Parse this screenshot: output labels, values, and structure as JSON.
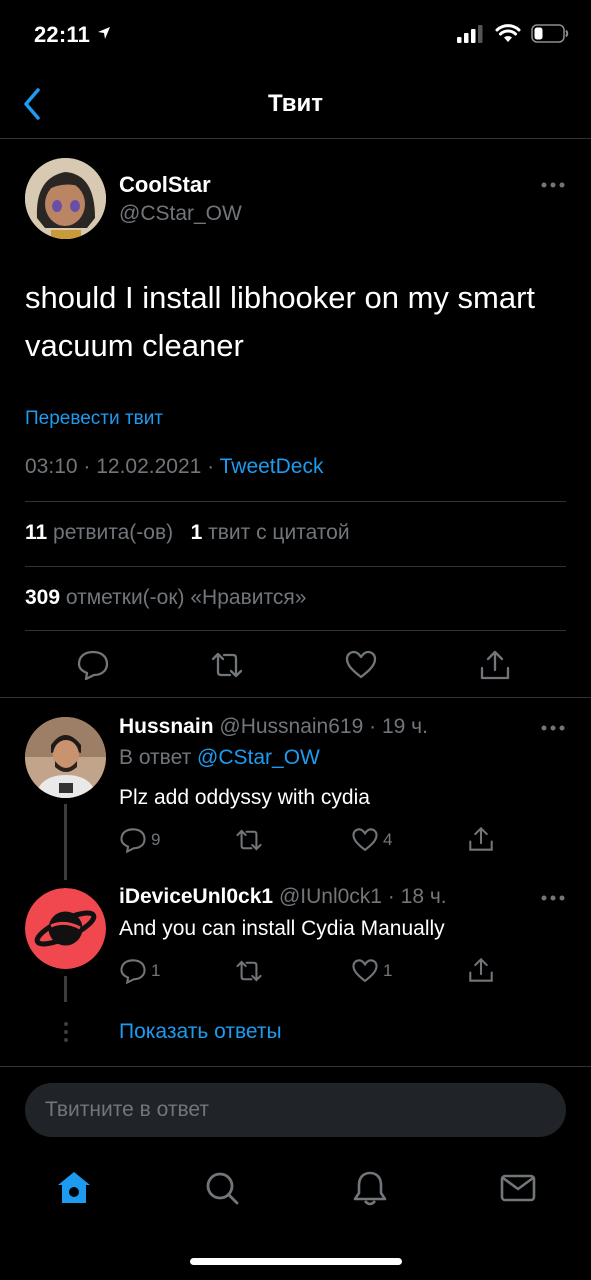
{
  "status_bar": {
    "time": "22:11"
  },
  "nav": {
    "title": "Твит"
  },
  "tweet": {
    "author_name": "CoolStar",
    "author_handle": "@CStar_OW",
    "text": "should I install libhooker on my smart vacuum cleaner",
    "translate": "Перевести твит",
    "timestamp": "03:10 · 12.02.2021 · ",
    "source": "TweetDeck",
    "retweets_count": "11",
    "retweets_label": "ретвита(-ов)",
    "quotes_count": "1",
    "quotes_label": "твит с цитатой",
    "likes_count": "309",
    "likes_label": "отметки(-ок) «Нравится»"
  },
  "replies": [
    {
      "author_name": "Hussnain",
      "meta": "@Hussnain619 · 19 ч.",
      "reply_to_label": "В ответ",
      "reply_to_handle": "@CStar_OW",
      "text": "Plz add oddyssy with cydia",
      "reply_count": "9",
      "like_count": "4"
    },
    {
      "author_name": "iDeviceUnl0ck1",
      "meta": "@IUnl0ck1 · 18 ч.",
      "text": "And you can install Cydia Manually",
      "reply_count": "1",
      "like_count": "1"
    }
  ],
  "show_replies": "Показать ответы",
  "reply_input": {
    "placeholder": "Твитните в ответ"
  },
  "colors": {
    "accent": "#1d9bf0",
    "secondary_text": "#71767b",
    "background": "#000000"
  },
  "icons": [
    "location-arrow-icon",
    "signal-icon",
    "wifi-icon",
    "battery-icon",
    "back-chevron-icon",
    "more-icon",
    "reply-icon",
    "retweet-icon",
    "like-icon",
    "share-icon",
    "home-icon",
    "search-icon",
    "notifications-icon",
    "messages-icon"
  ]
}
